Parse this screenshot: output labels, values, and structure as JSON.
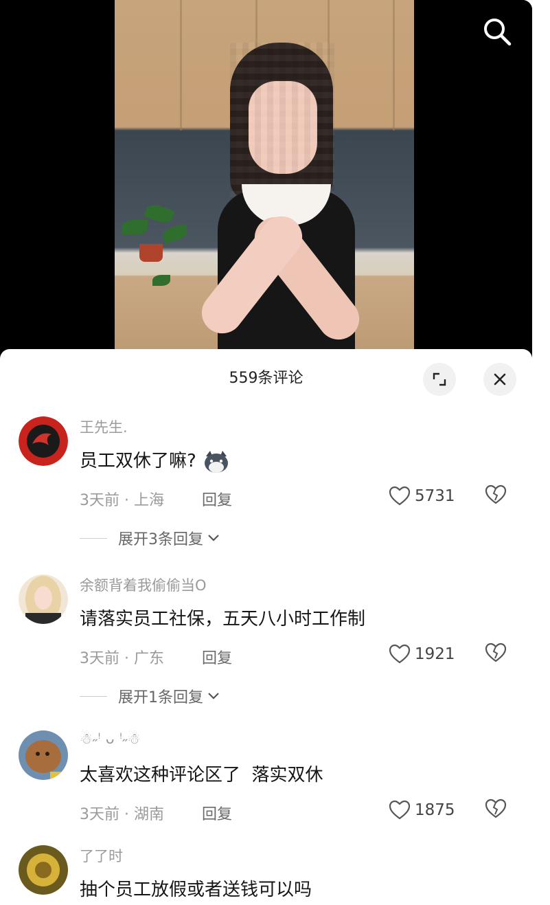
{
  "header": {
    "comment_count_title": "559条评论"
  },
  "icons": {
    "search": "search-icon",
    "expand_view": "expand-arrows-icon",
    "close": "close-icon",
    "like": "heart-icon",
    "dislike": "broken-heart-icon",
    "chevron": "chevron-down-icon"
  },
  "comments": [
    {
      "username": "王先生.",
      "text": "员工双休了嘛?",
      "time": "3天前",
      "location": "上海",
      "reply_label": "回复",
      "likes": "5731",
      "expand_label": "展开3条回复",
      "has_emoji": true
    },
    {
      "username": "余额背着我偷偷当O",
      "text": "请落实员工社保，五天八小时工作制",
      "time": "3天前",
      "location": "广东",
      "reply_label": "回复",
      "likes": "1921",
      "expand_label": "展开1条回复"
    },
    {
      "username": "☃︎˶ꜝ ᴗ ꜝ˶☃︎",
      "text": "太喜欢这种评论区了  落实双休",
      "time": "3天前",
      "location": "湖南",
      "reply_label": "回复",
      "likes": "1875"
    },
    {
      "username": "了了时",
      "text": "抽个员工放假或者送钱可以吗"
    }
  ],
  "colors": {
    "sheet_bg": "#ffffff",
    "meta_text": "#9a9a9a",
    "video_bg": "#000000"
  }
}
